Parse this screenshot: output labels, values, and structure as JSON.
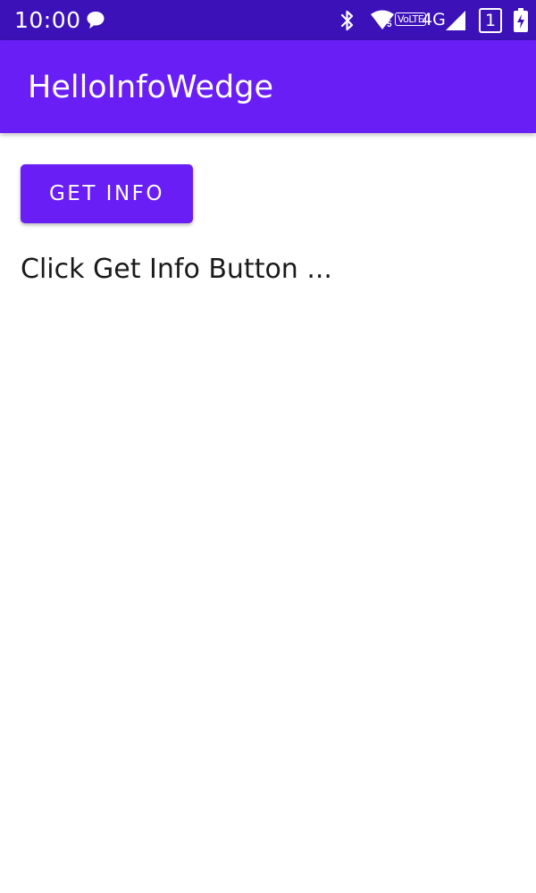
{
  "status_bar": {
    "time": "10:00",
    "network_type": "4G",
    "volte_label": "VoLTE",
    "wifi_sub_label": "5",
    "sim_slot": "1",
    "icons": [
      "chat-bubble-icon",
      "bluetooth-icon",
      "wifi-icon",
      "signal-icon",
      "battery-charging-icon"
    ],
    "background_color": "#3c12b8"
  },
  "app_bar": {
    "title": "HelloInfoWedge",
    "background_color": "#6a1ef6"
  },
  "main": {
    "get_info_button_label": "GET INFO",
    "info_text": "Click Get Info Button ..."
  }
}
